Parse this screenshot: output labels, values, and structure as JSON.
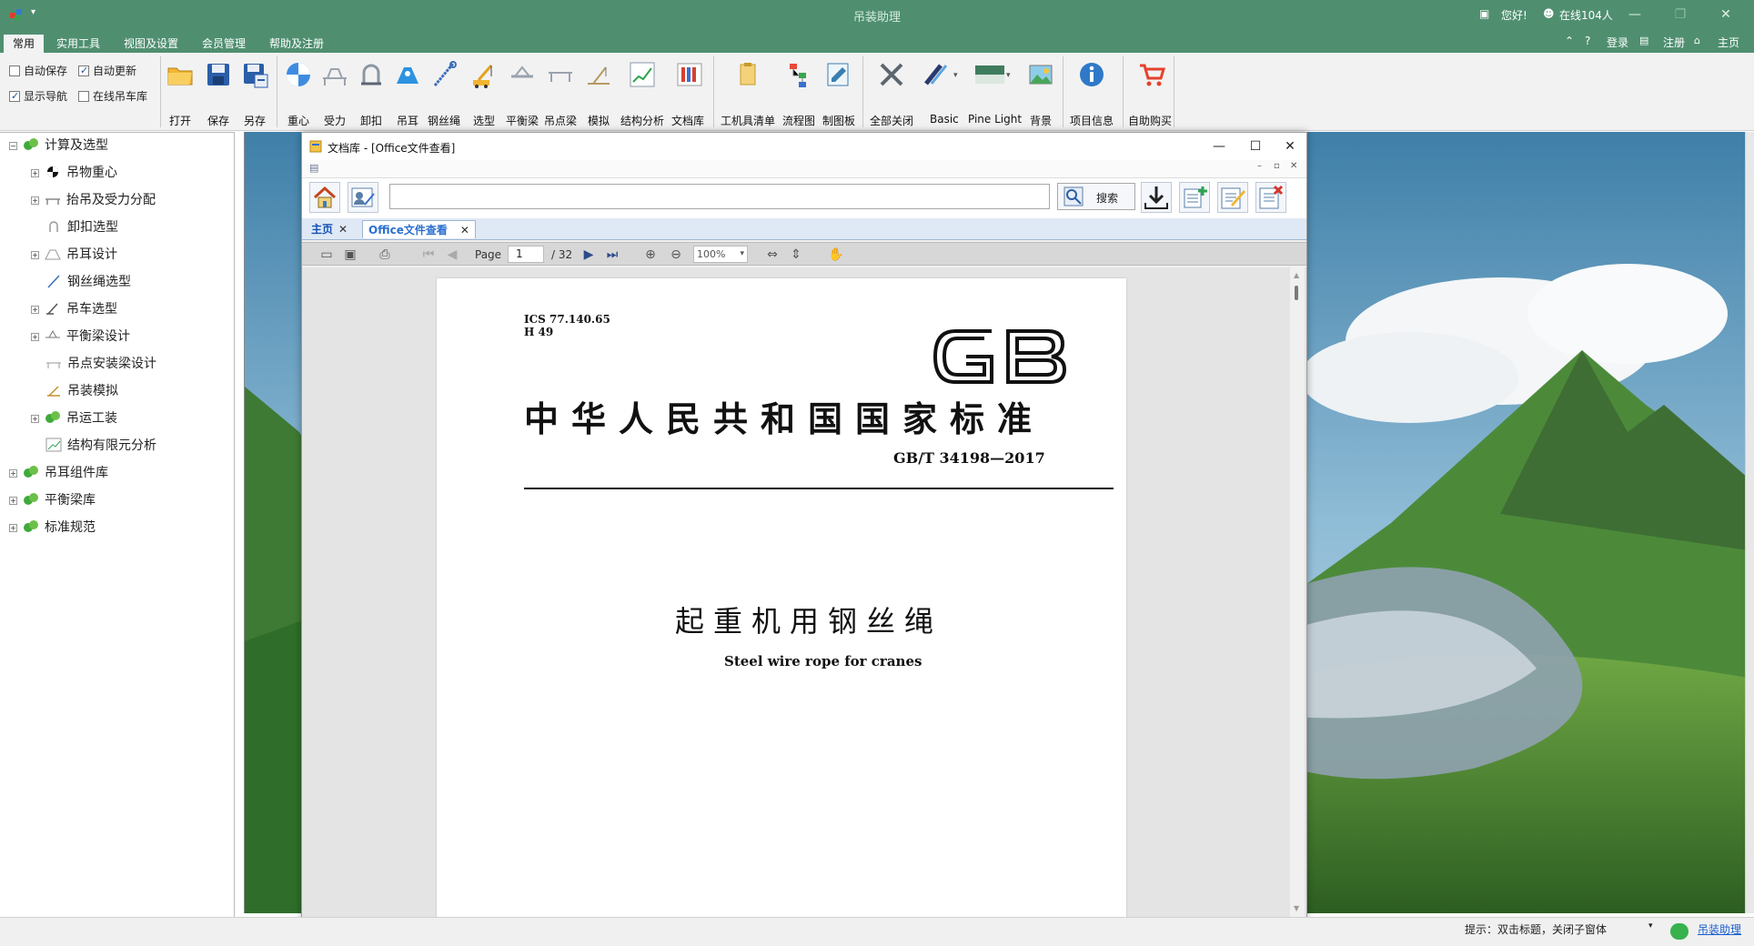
{
  "app": {
    "title": "吊装助理",
    "greeting": "您好!",
    "online": "在线104人",
    "login": "登录",
    "register": "注册",
    "home": "主页"
  },
  "ribbon_tabs": [
    "常用",
    "实用工具",
    "视图及设置",
    "会员管理",
    "帮助及注册"
  ],
  "checkboxes": {
    "auto_save": {
      "label": "自动保存",
      "checked": false
    },
    "auto_update": {
      "label": "自动更新",
      "checked": true
    },
    "show_nav": {
      "label": "显示导航",
      "checked": true
    },
    "online_library": {
      "label": "在线吊车库",
      "checked": false
    }
  },
  "ribbon_buttons": {
    "open": "打开",
    "save": "保存",
    "save_as": "另存",
    "center_gravity": "重心",
    "force": "受力",
    "shackle": "卸扣",
    "lug": "吊耳",
    "wire_rope": "钢丝绳",
    "selection": "选型",
    "balance_beam": "平衡梁",
    "lift_beam": "吊点梁",
    "simulate": "模拟",
    "structure": "结构分析",
    "doc_lib": "文档库",
    "tool_list": "工机具清单",
    "flowchart": "流程图",
    "drawing_board": "制图板",
    "close_all": "全部关闭",
    "basic": "Basic",
    "pine_light": "Pine Light",
    "background": "背景",
    "project_info": "项目信息",
    "buy": "自助购买"
  },
  "tree": {
    "calc": "计算及选型",
    "children": [
      "吊物重心",
      "抬吊及受力分配",
      "卸扣选型",
      "吊耳设计",
      "钢丝绳选型",
      "吊车选型",
      "平衡梁设计",
      "吊点安装梁设计",
      "吊装模拟",
      "吊运工装",
      "结构有限元分析"
    ],
    "lug_library": "吊耳组件库",
    "beam_library": "平衡梁库",
    "standards": "标准规范"
  },
  "doc_window": {
    "title": "文档库 - [Office文件查看]",
    "search_label": "搜索",
    "search_value": "",
    "tabs": [
      "主页",
      "Office文件查看"
    ],
    "page_label": "Page",
    "page_current": "1",
    "page_total": "/ 32",
    "zoom": "100%"
  },
  "pdf_page": {
    "ics": "ICS  77.140.65",
    "class": "H  49",
    "logo": "GB",
    "title_cn": "中华人民共和国国家标准",
    "std_no": "GB/T  34198—2017",
    "doc_title_cn": "起重机用钢丝绳",
    "doc_title_en": "Steel wire rope for cranes"
  },
  "status": {
    "hint": "提示：双击标题，关闭子窗体",
    "link": "吊装助理"
  },
  "colors": {
    "title_bar": "#4f8f70",
    "ribbon_bg": "#f2f2f2",
    "tab_active_text": "#2a6fd0",
    "link": "#1a5fd0"
  }
}
